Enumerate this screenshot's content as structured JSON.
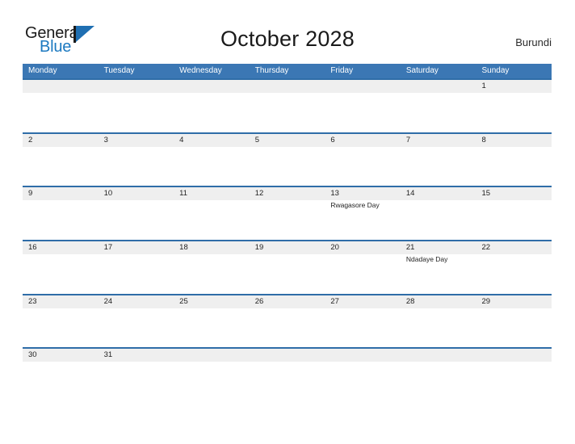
{
  "brand": {
    "name_part1": "General",
    "name_part2": "Blue",
    "mark_icon": "triangle-flag-icon",
    "accent_color": "#1f6fb2",
    "text_color": "#1a1a1a"
  },
  "header": {
    "title": "October 2028",
    "country": "Burundi"
  },
  "theme": {
    "header_blue": "#3b77b4",
    "row_divider_blue": "#2f6da8",
    "date_band_gray": "#efefef",
    "page_background": "#ffffff"
  },
  "calendar": {
    "month": "October",
    "year": "2028",
    "weekday_headers": [
      "Monday",
      "Tuesday",
      "Wednesday",
      "Thursday",
      "Friday",
      "Saturday",
      "Sunday"
    ],
    "weeks": [
      [
        {
          "day": "",
          "event": ""
        },
        {
          "day": "",
          "event": ""
        },
        {
          "day": "",
          "event": ""
        },
        {
          "day": "",
          "event": ""
        },
        {
          "day": "",
          "event": ""
        },
        {
          "day": "",
          "event": ""
        },
        {
          "day": "1",
          "event": ""
        }
      ],
      [
        {
          "day": "2",
          "event": ""
        },
        {
          "day": "3",
          "event": ""
        },
        {
          "day": "4",
          "event": ""
        },
        {
          "day": "5",
          "event": ""
        },
        {
          "day": "6",
          "event": ""
        },
        {
          "day": "7",
          "event": ""
        },
        {
          "day": "8",
          "event": ""
        }
      ],
      [
        {
          "day": "9",
          "event": ""
        },
        {
          "day": "10",
          "event": ""
        },
        {
          "day": "11",
          "event": ""
        },
        {
          "day": "12",
          "event": ""
        },
        {
          "day": "13",
          "event": "Rwagasore Day"
        },
        {
          "day": "14",
          "event": ""
        },
        {
          "day": "15",
          "event": ""
        }
      ],
      [
        {
          "day": "16",
          "event": ""
        },
        {
          "day": "17",
          "event": ""
        },
        {
          "day": "18",
          "event": ""
        },
        {
          "day": "19",
          "event": ""
        },
        {
          "day": "20",
          "event": ""
        },
        {
          "day": "21",
          "event": "Ndadaye Day"
        },
        {
          "day": "22",
          "event": ""
        }
      ],
      [
        {
          "day": "23",
          "event": ""
        },
        {
          "day": "24",
          "event": ""
        },
        {
          "day": "25",
          "event": ""
        },
        {
          "day": "26",
          "event": ""
        },
        {
          "day": "27",
          "event": ""
        },
        {
          "day": "28",
          "event": ""
        },
        {
          "day": "29",
          "event": ""
        }
      ],
      [
        {
          "day": "30",
          "event": ""
        },
        {
          "day": "31",
          "event": ""
        },
        {
          "day": "",
          "event": ""
        },
        {
          "day": "",
          "event": ""
        },
        {
          "day": "",
          "event": ""
        },
        {
          "day": "",
          "event": ""
        },
        {
          "day": "",
          "event": ""
        }
      ]
    ],
    "holidays": [
      {
        "date": "13",
        "name": "Rwagasore Day"
      },
      {
        "date": "21",
        "name": "Ndadaye Day"
      }
    ]
  }
}
